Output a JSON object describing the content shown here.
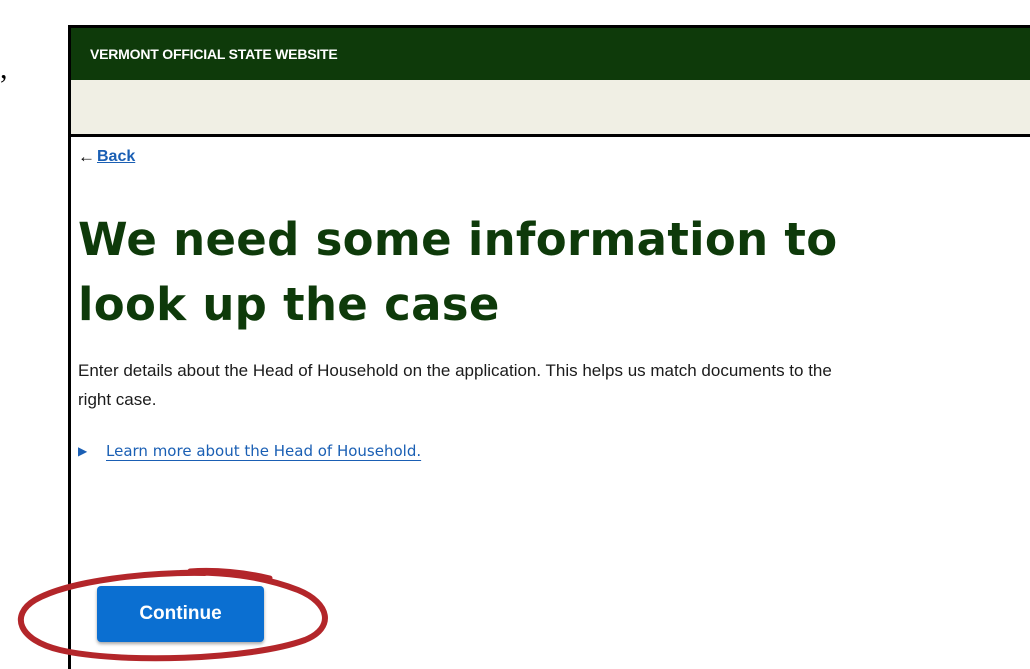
{
  "stray_mark": ",",
  "banner": {
    "label": "VERMONT OFFICIAL STATE WEBSITE"
  },
  "back_link": {
    "arrow": "←",
    "label": "Back"
  },
  "page": {
    "title": "We need some information to look up the case",
    "intro": "Enter details about the Head of Household on the application. This helps us match documents to the right case."
  },
  "disclosure": {
    "label": "Learn more about the Head of Household."
  },
  "continue_button": {
    "label": "Continue"
  },
  "colors": {
    "banner_green": "#0e3a0a",
    "sub_banner": "#f0efe4",
    "link_blue": "#1a5fb4",
    "button_blue": "#0b6fd1",
    "annotation_red": "#b3262a"
  },
  "icons": {
    "back": "left-arrow-icon",
    "disclosure": "triangle-right-icon"
  }
}
